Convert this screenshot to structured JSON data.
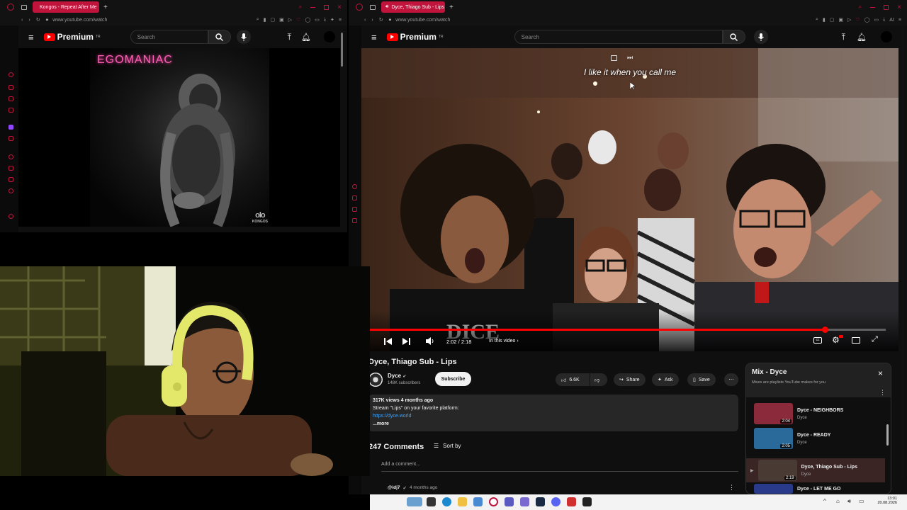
{
  "left_browser": {
    "tab_title": "Kongos - Repeat After Me",
    "url": "www.youtube.com/watch",
    "search_placeholder": "Search",
    "brand": "Premium",
    "region": "TR"
  },
  "left_album": {
    "title_text": "EGOMANIAC",
    "band_text": "KONGOS"
  },
  "right_browser": {
    "tab_title": "Dyce, Thiago Sub - Lips",
    "url": "www.youtube.com/watch",
    "ai_label": "AI",
    "search_placeholder": "Search",
    "brand": "Premium",
    "region": "TR"
  },
  "player": {
    "caption": "I like it when you call me",
    "time": "2:02 / 2:18",
    "chapters": "In this video",
    "progress": 0.884
  },
  "video": {
    "title": "Dyce, Thiago Sub - Lips",
    "channel": "Dyce",
    "subscribers": "148K subscribers",
    "subscribe_label": "Subscribe",
    "likes": "6.6K",
    "share_label": "Share",
    "ask_label": "Ask",
    "save_label": "Save",
    "stats": "317K views  4 months ago",
    "desc_line": "Stream \"Lips\" on your favorite platform:",
    "desc_link": "https://dyce.world",
    "more_label": "...more"
  },
  "comments": {
    "count": "247 Comments",
    "sort_label": "Sort by",
    "placeholder": "Add a comment...",
    "first_author": "@idj7",
    "first_time": "4 months ago"
  },
  "playlist": {
    "title": "Mix - Dyce",
    "subtitle": "Mixes are playlists YouTube makes for you",
    "items": [
      {
        "title": "Dyce - NEIGHBORS",
        "channel": "Dyce",
        "duration": "2:04",
        "color": "#8a2a3a"
      },
      {
        "title": "Dyce - READY",
        "channel": "Dyce",
        "duration": "2:05",
        "color": "#2a6a9a"
      },
      {
        "title": "Dyce, Thiago Sub - Lips",
        "channel": "Dyce",
        "duration": "2:19",
        "color": "#4a3a34"
      },
      {
        "title": "Dyce - LET ME GO",
        "channel": "",
        "duration": "",
        "color": "#2a3a8a"
      }
    ]
  },
  "taskbar": {
    "clock_time": "13:01",
    "clock_date": "20.08.2026"
  },
  "colors": {
    "accent": "#c0143c",
    "youtube_red": "#ff0000",
    "progress_red": "#f00",
    "headphones": "#e4e86a"
  }
}
